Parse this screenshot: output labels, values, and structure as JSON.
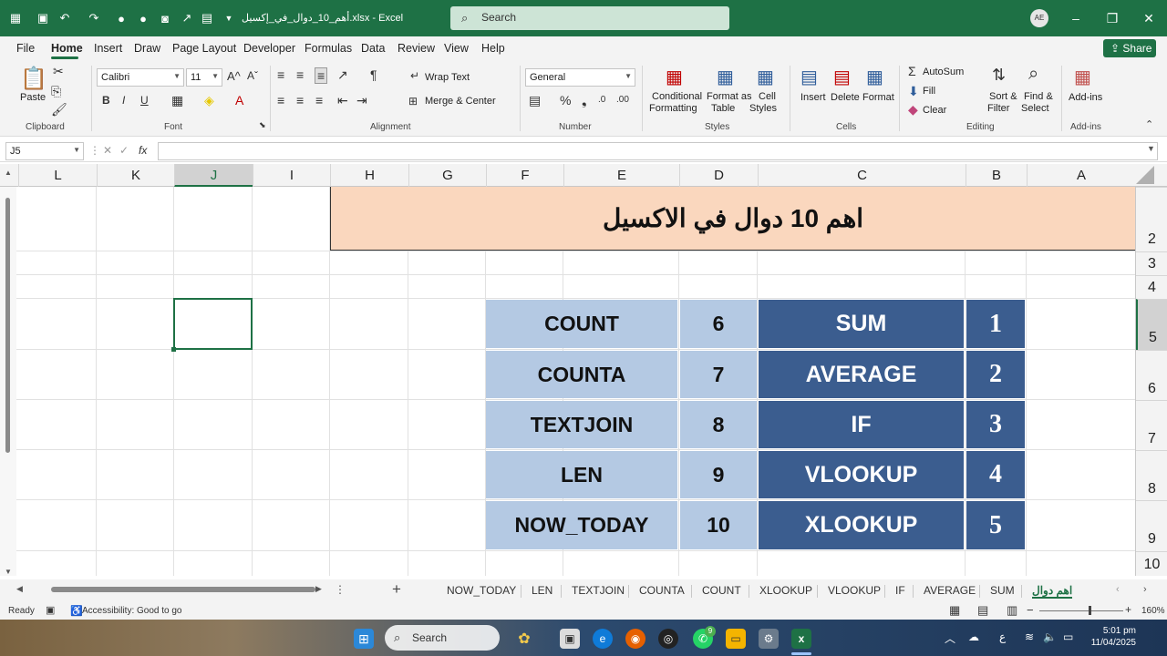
{
  "titlebar": {
    "doc_title": "أهم_10_دوال_في_إكسيل.xlsx - Excel",
    "search_placeholder": "Search",
    "avatar": "AE",
    "accent": "#1e7145"
  },
  "menu": [
    "File",
    "Home",
    "Insert",
    "Draw",
    "Page Layout",
    "Developer",
    "Formulas",
    "Data",
    "Review",
    "View",
    "Help"
  ],
  "share_label": "Share",
  "ribbon": {
    "clipboard": {
      "paste": "Paste",
      "label": "Clipboard"
    },
    "font": {
      "name": "Calibri",
      "size": "11",
      "label": "Font"
    },
    "alignment": {
      "wrap": "Wrap Text",
      "merge": "Merge & Center",
      "label": "Alignment"
    },
    "number": {
      "format": "General",
      "label": "Number"
    },
    "styles": {
      "cond1": "Conditional",
      "cond2": "Formatting",
      "fat1": "Format as",
      "fat2": "Table",
      "cs1": "Cell",
      "cs2": "Styles",
      "label": "Styles"
    },
    "cells": {
      "insert": "Insert",
      "delete": "Delete",
      "format": "Format",
      "label": "Cells"
    },
    "editing": {
      "autosum": "AutoSum",
      "fill": "Fill",
      "clear": "Clear",
      "sort1": "Sort &",
      "sort2": "Filter",
      "find1": "Find &",
      "find2": "Select",
      "label": "Editing"
    },
    "addins": {
      "btn": "Add-ins",
      "label": "Add-ins"
    }
  },
  "formula": {
    "namebox": "J5",
    "fx": "fx",
    "value": ""
  },
  "columns": [
    "L",
    "K",
    "J",
    "I",
    "H",
    "G",
    "F",
    "E",
    "D",
    "C",
    "B",
    "A"
  ],
  "selected_column": "J",
  "rows": [
    "2",
    "3",
    "4",
    "5",
    "6",
    "7",
    "8",
    "9",
    "10"
  ],
  "selected_row": "5",
  "banner_title": "اهم 10 دوال في الاكسيل",
  "functions": [
    {
      "num": "1",
      "name": "SUM"
    },
    {
      "num": "2",
      "name": "AVERAGE"
    },
    {
      "num": "3",
      "name": "IF"
    },
    {
      "num": "4",
      "name": "VLOOKUP"
    },
    {
      "num": "5",
      "name": "XLOOKUP"
    },
    {
      "num": "6",
      "name": "COUNT"
    },
    {
      "num": "7",
      "name": "COUNTA"
    },
    {
      "num": "8",
      "name": "TEXTJOIN"
    },
    {
      "num": "9",
      "name": "LEN"
    },
    {
      "num": "10",
      "name": "NOW_TODAY"
    }
  ],
  "colors": {
    "light_cell": "#b4c9e3",
    "dark_cell": "#3b5d8f",
    "banner": "#fad7be"
  },
  "sheet_tabs": [
    "NOW_TODAY",
    "LEN",
    "TEXTJOIN",
    "COUNTA",
    "COUNT",
    "XLOOKUP",
    "VLOOKUP",
    "IF",
    "AVERAGE",
    "SUM",
    "اهم دوال"
  ],
  "active_tab": "اهم دوال",
  "status": {
    "ready": "Ready",
    "accessibility": "Accessibility: Good to go",
    "zoom": "160%"
  },
  "taskbar": {
    "search": "Search",
    "badge": "9",
    "lang": "ع",
    "time": "5:01 pm",
    "date": "11/04/2025"
  }
}
